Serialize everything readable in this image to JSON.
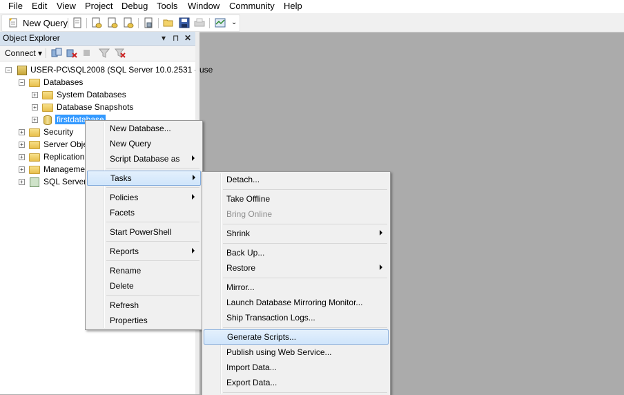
{
  "menubar": {
    "items": [
      "File",
      "Edit",
      "View",
      "Project",
      "Debug",
      "Tools",
      "Window",
      "Community",
      "Help"
    ]
  },
  "toolbar": {
    "new_query": "New Query",
    "more": "⌄"
  },
  "object_explorer": {
    "title": "Object Explorer",
    "controls": {
      "dropdown": "▾",
      "pin": "⊓",
      "close": "✕"
    },
    "connect": "Connect ▾",
    "tree": {
      "server": "USER-PC\\SQL2008 (SQL Server 10.0.2531 - use",
      "databases": "Databases",
      "system_databases": "System Databases",
      "database_snapshots": "Database Snapshots",
      "firstdatabase": "firstdatabase",
      "security": "Security",
      "server_objects": "Server Obje",
      "replication": "Replication",
      "management": "Manageme",
      "sql_server_agent": "SQL Server",
      "expand_plus": "+",
      "expand_minus": "−"
    }
  },
  "context_menu": {
    "new_database": "New Database...",
    "new_query": "New Query",
    "script_database_as": "Script Database as",
    "tasks": "Tasks",
    "policies": "Policies",
    "facets": "Facets",
    "start_powershell": "Start PowerShell",
    "reports": "Reports",
    "rename": "Rename",
    "delete": "Delete",
    "refresh": "Refresh",
    "properties": "Properties"
  },
  "tasks_menu": {
    "detach": "Detach...",
    "take_offline": "Take Offline",
    "bring_online": "Bring Online",
    "shrink": "Shrink",
    "back_up": "Back Up...",
    "restore": "Restore",
    "mirror": "Mirror...",
    "launch_mirroring_monitor": "Launch Database Mirroring Monitor...",
    "ship_transaction_logs": "Ship Transaction Logs...",
    "generate_scripts": "Generate Scripts...",
    "publish_web_service": "Publish using Web Service...",
    "import_data": "Import Data...",
    "export_data": "Export Data..."
  }
}
